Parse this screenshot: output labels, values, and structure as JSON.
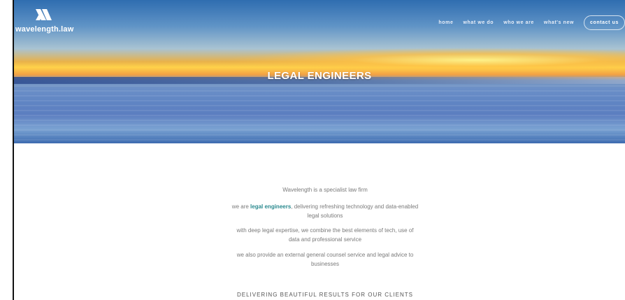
{
  "brand": {
    "logo_text": "wavelength.law"
  },
  "nav": {
    "items": [
      "home",
      "what we do",
      "who we are",
      "what's new"
    ],
    "contact_label": "contact us"
  },
  "hero": {
    "title": "LEGAL ENGINEERS"
  },
  "content": {
    "p1": "Wavelength is a specialist law firm",
    "p2_prefix": "we are ",
    "p2_highlight": "legal engineers",
    "p2_suffix": ", delivering refreshing technology and data-enabled legal solutions",
    "p3": "with deep legal expertise, we combine the best elements of tech, use of data and professional service",
    "p4": "we also provide an external general counsel service and legal advice to businesses",
    "tagline": "DELIVERING BEAUTIFUL RESULTS FOR OUR CLIENTS"
  },
  "colors": {
    "highlight": "#2b8a8f",
    "text_muted": "#7a7a7a"
  }
}
